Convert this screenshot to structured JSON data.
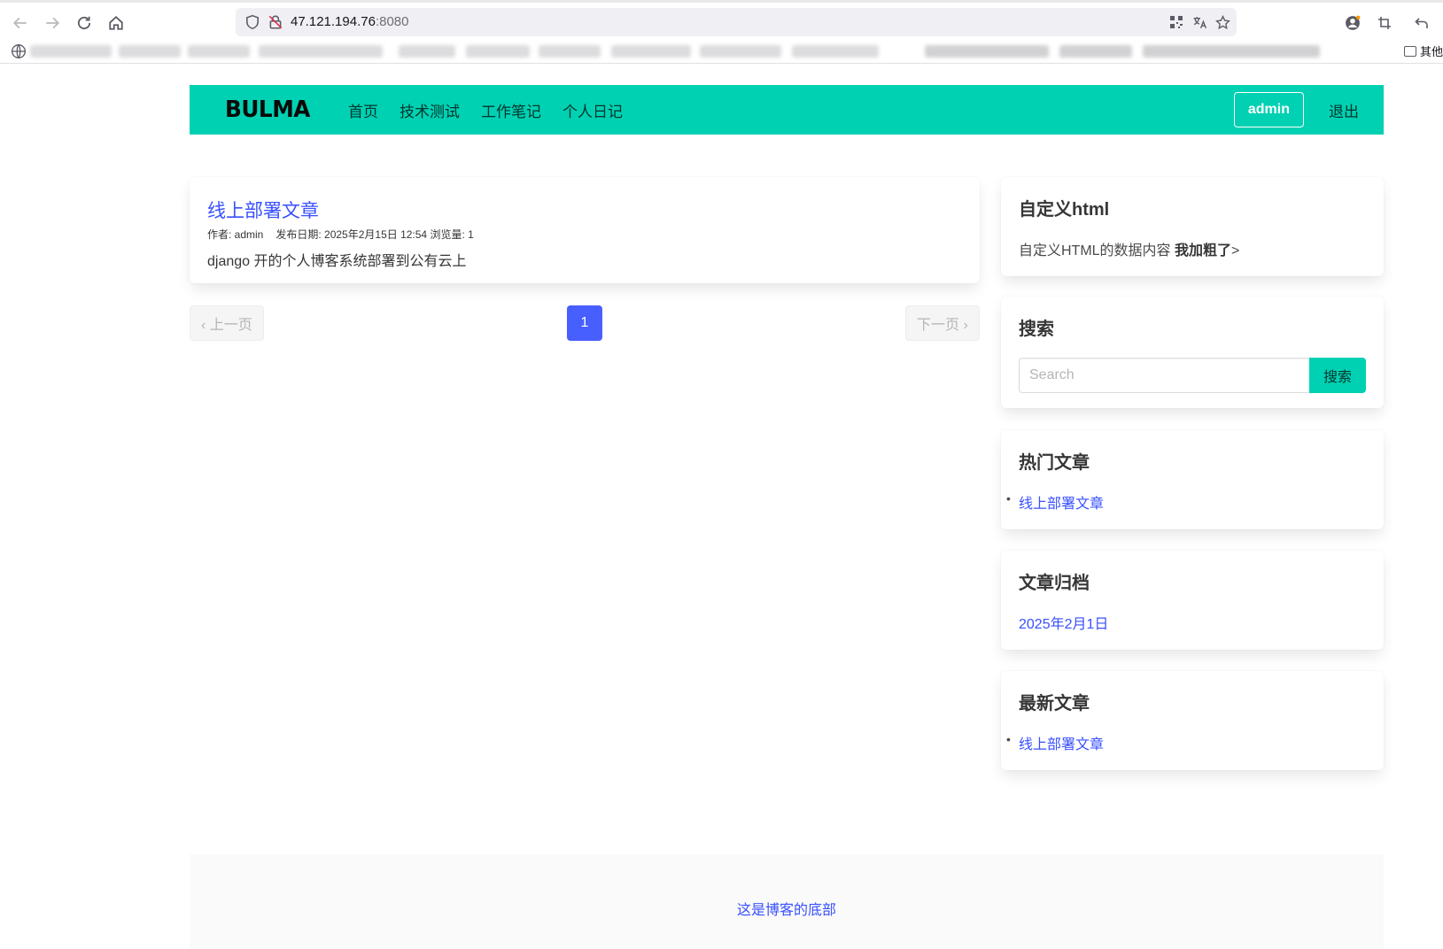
{
  "browser": {
    "url_host": "47.121.194.76",
    "url_port": ":8080",
    "bookmarks_other": "其他"
  },
  "navbar": {
    "brand": "BULMA",
    "links": [
      "首页",
      "技术测试",
      "工作笔记",
      "个人日记"
    ],
    "user": "admin",
    "logout": "退出"
  },
  "post": {
    "title": "线上部署文章",
    "meta_author": "作者: admin",
    "meta_date_views": "发布日期: 2025年2月15日 12:54 浏览量: 1",
    "excerpt": "django 开的个人博客系统部署到公有云上"
  },
  "pagination": {
    "prev": "‹ 上一页",
    "current": "1",
    "next": "下一页 ›"
  },
  "sidebar": {
    "custom_html": {
      "title": "自定义html",
      "text": "自定义HTML的数据内容 ",
      "bold": "我加粗了",
      "suffix": ">"
    },
    "search": {
      "title": "搜索",
      "placeholder": "Search",
      "button": "搜索"
    },
    "hot": {
      "title": "热门文章",
      "items": [
        "线上部署文章"
      ]
    },
    "archive": {
      "title": "文章归档",
      "items": [
        "2025年2月1日"
      ]
    },
    "latest": {
      "title": "最新文章",
      "items": [
        "线上部署文章"
      ]
    }
  },
  "footer": {
    "text": "这是博客的底部"
  }
}
